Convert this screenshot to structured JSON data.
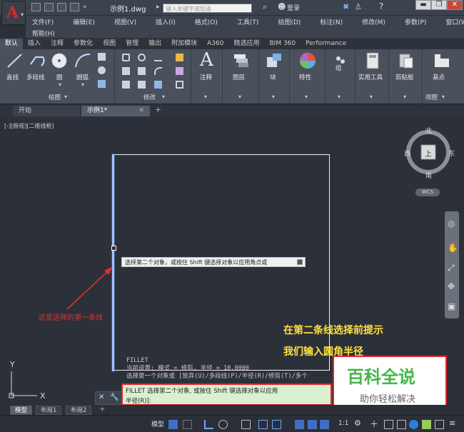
{
  "app": {
    "filename": "示例1.dwg",
    "search_placeholder": "键入关键字或短语",
    "login": "登录",
    "help_icon": "question-circle-icon"
  },
  "menu": [
    "文件(F)",
    "编辑(E)",
    "视图(V)",
    "插入(I)",
    "格式(O)",
    "工具(T)",
    "绘图(D)",
    "标注(N)",
    "修改(M)",
    "参数(P)",
    "窗口(W)"
  ],
  "menu_help": "帮助(H)",
  "ribbon_tabs": [
    "默认",
    "插入",
    "注释",
    "参数化",
    "视图",
    "管理",
    "输出",
    "附加模块",
    "A360",
    "精选应用",
    "BIM 360",
    "Performance"
  ],
  "ribbon": {
    "draw_tools": [
      "直线",
      "多段线",
      "圆",
      "圆弧"
    ],
    "draw_group": "绘图",
    "modify_group": "修改",
    "panels": [
      "注释",
      "图层",
      "块",
      "特性",
      "组",
      "实用工具",
      "剪贴板",
      "基点"
    ],
    "view_group": "视图"
  },
  "doc_tabs": [
    "开始",
    "示例1*"
  ],
  "viewport_label": "[-][俯视][二维线框]",
  "compass": {
    "north": "北",
    "south": "南",
    "east": "东",
    "west": "西",
    "top": "上",
    "wcs": "WCS"
  },
  "tooltip": "选择第二个对象，或按住 Shift 键选择对象以应用角点或",
  "annotations": {
    "first_line": "这是选择的第一条线",
    "hint_line1": "在第二条线选择前提示",
    "hint_line2": "我们输入圆角半径"
  },
  "command": {
    "history": [
      "FILLET",
      "当前设置: 模式 = 修剪, 半径 = 10.0000",
      "选择第一个对象或 [放弃(U)/多段线(P)/半径(R)/修剪(T)/多个"
    ],
    "prompt_line1": "FILLET 选择第二个对象, 或按住 Shift 键选择对象以应用",
    "prompt_line2": "半径(R)]:"
  },
  "watermark": {
    "title": "百科全说",
    "subtitle": "助你轻松解决"
  },
  "layout_tabs": [
    "模型",
    "布局1",
    "布局2"
  ],
  "status": {
    "model": "模型",
    "scale": "1:1"
  }
}
